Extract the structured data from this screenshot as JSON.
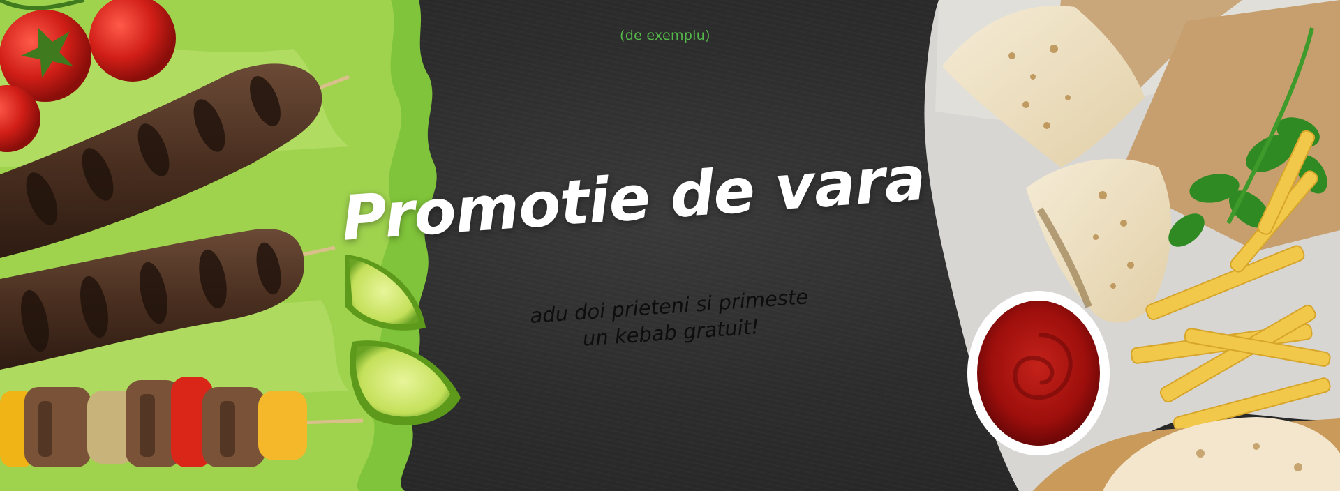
{
  "banner": {
    "hint": "(de exemplu)",
    "headline": "Promotie de vara",
    "subline_1": "adu doi prieteni si primeste",
    "subline_2": "un kebab gratuit!"
  },
  "colors": {
    "background": "#2c2c2c",
    "hint": "#55b84a",
    "headline": "#ffffff",
    "subline": "#0d0d0d"
  },
  "images": {
    "left": "kebab-skewers-lettuce-tomatoes-lime",
    "right": "wrapped-burritos-ketchup-fries-parsley"
  }
}
